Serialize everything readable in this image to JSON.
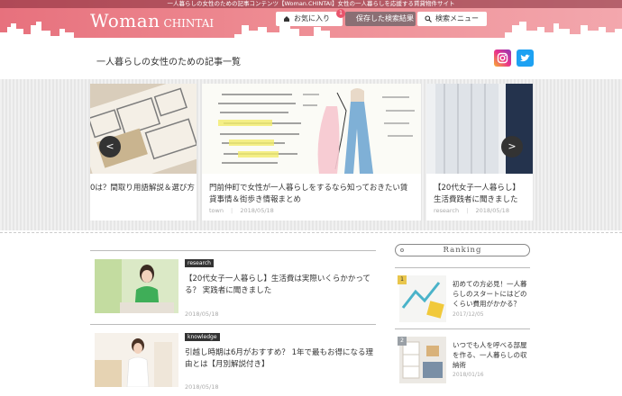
{
  "header": {
    "tagline": "一人暮らしの女性のための記事コンテンツ【Woman.CHINTAI】女性の一人暮らしを応援する賃貸物件サイト",
    "logo_main": "Woman",
    "logo_sub": "CHINTAI",
    "favorites_label": "お気に入り",
    "saved_search_label": "保存した検索結果",
    "saved_search_count": "1",
    "search_menu_label": "検索メニュー"
  },
  "page_title": "一人暮らしの女性のための記事一覧",
  "carousel": {
    "prev": "<",
    "next": ">",
    "cards": [
      {
        "title": "0は？間取り用語解説＆選び方",
        "category": "",
        "date": ""
      },
      {
        "title": "門前仲町で女性が一人暮らしをするなら知っておきたい賃貸事情＆街歩き情報まとめ",
        "category": "town",
        "date": "2018/05/18"
      },
      {
        "title": "【20代女子一人暮らし】生活費践者に聞きました",
        "category": "research",
        "date": "2018/05/18"
      }
    ]
  },
  "articles": [
    {
      "tag": "research",
      "title": "【20代女子一人暮らし】生活費は実際いくらかかってる？ 実践者に聞きました",
      "date": "2018/05/18"
    },
    {
      "tag": "knowledge",
      "title": "引越し時期は6月がおすすめ？ 1年で最もお得になる理由とは【月別解説付き】",
      "date": "2018/05/18"
    }
  ],
  "ranking": {
    "title": "Ranking",
    "items": [
      {
        "rank": "1",
        "title": "初めての方必見！一人暮らしのスタートにはどのくらい費用がかかる？",
        "date": "2017/12/05"
      },
      {
        "rank": "2",
        "title": "いつでも人を呼べる部屋を作る、一人暮らしの収納術",
        "date": "2018/01/16"
      }
    ]
  },
  "colors": {
    "header_pink": "#ee8c93",
    "rank_gold": "#e9c64c",
    "twitter": "#1da1f2"
  }
}
